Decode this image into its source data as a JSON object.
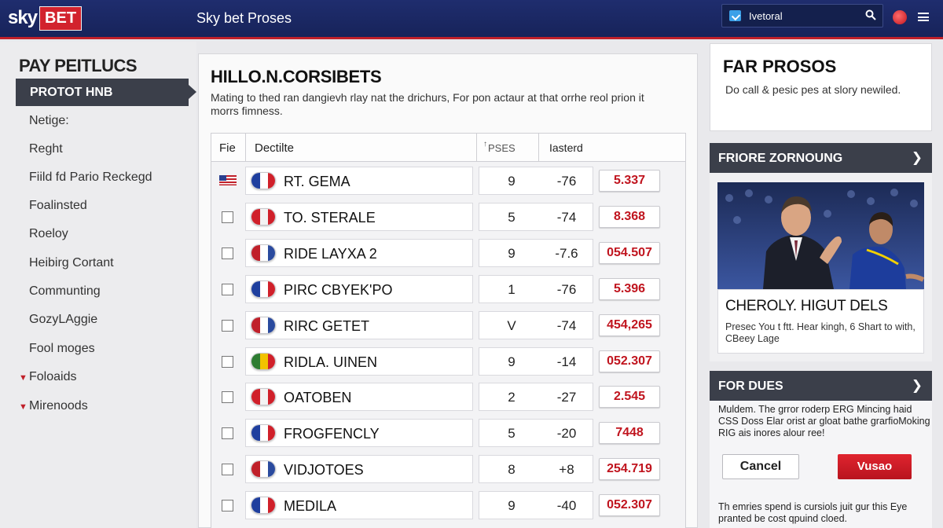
{
  "header": {
    "logo_sky": "sky",
    "logo_bet": "BET",
    "app_title": "Sky bet Proses",
    "search_value": "Ivetoral",
    "colors": {
      "bar": "#1f2d6e",
      "accent": "#c0202a"
    }
  },
  "sidebar": {
    "heading": "PAY PEITLUCS",
    "active": "PROTOT HNB",
    "items": [
      {
        "label": "Netige:"
      },
      {
        "label": "Reght"
      },
      {
        "label": "Fiild fd Pario Reckegd"
      },
      {
        "label": "Foalinsted"
      },
      {
        "label": "Roeloy"
      },
      {
        "label": "Heibirg Cortant"
      },
      {
        "label": "Communting"
      },
      {
        "label": "GozyLAggie"
      },
      {
        "label": "Fool moges"
      },
      {
        "label": "Foloaids",
        "arrow": "▼"
      },
      {
        "label": "Mirenoods",
        "arrow": "▼"
      }
    ]
  },
  "main": {
    "title": "HILLO.N.CORSIBETS",
    "description": "Mating to thed ran dangievh rlay nat the drichurs, For pon actaur at that orrhe reol prion it morrs fimness.",
    "columns": {
      "c1": "Fie",
      "c2": "Dectilte",
      "c3": "PSES",
      "c4": "Iasterd"
    },
    "rows": [
      {
        "name": "RT. GEMA",
        "num": "9",
        "chg": "-76",
        "odds": "5.337",
        "lead": "flag",
        "badge": [
          "#1f3f9e",
          "#ffffff",
          "#d0202a"
        ]
      },
      {
        "name": "TO. STERALE",
        "num": "5",
        "chg": "-74",
        "odds": "8.368",
        "lead": "check",
        "badge": [
          "#d0202a",
          "#f3f3f3",
          "#d0202a"
        ]
      },
      {
        "name": "RIDE LAYXA 2",
        "num": "9",
        "chg": "-7.6",
        "odds": "054.507",
        "lead": "check",
        "badge": [
          "#c0202a",
          "#ffffff",
          "#2a4a9e"
        ]
      },
      {
        "name": "PIRC CBYEK'PO",
        "num": "1",
        "chg": "-76",
        "odds": "5.396",
        "lead": "check",
        "badge": [
          "#1f3f9e",
          "#ffffff",
          "#d0202a"
        ]
      },
      {
        "name": "RIRC GETET",
        "num": "V",
        "chg": "-74",
        "odds": "454,265",
        "lead": "check",
        "badge": [
          "#c0202a",
          "#ffffff",
          "#2a4a9e"
        ]
      },
      {
        "name": "RIDLA. UINEN",
        "num": "9",
        "chg": "-14",
        "odds": "052.307",
        "lead": "check",
        "badge": [
          "#2e7d32",
          "#f2c200",
          "#d0202a"
        ]
      },
      {
        "name": "OATOBEN",
        "num": "2",
        "chg": "-27",
        "odds": "2.545",
        "lead": "check",
        "badge": [
          "#d0202a",
          "#f3f3f3",
          "#d0202a"
        ]
      },
      {
        "name": "FROGFENCLY",
        "num": "5",
        "chg": "-20",
        "odds": "7448",
        "lead": "check",
        "badge": [
          "#1f3f9e",
          "#ffffff",
          "#d0202a"
        ]
      },
      {
        "name": "VIDJOTOES",
        "num": "8",
        "chg": "+8",
        "odds": "254.719",
        "lead": "check",
        "badge": [
          "#c0202a",
          "#ffffff",
          "#2a4a9e"
        ]
      },
      {
        "name": "MEDILA",
        "num": "9",
        "chg": "-40",
        "odds": "052.307",
        "lead": "check",
        "badge": [
          "#1f3f9e",
          "#ffffff",
          "#d0202a"
        ]
      }
    ]
  },
  "right": {
    "box1_title": "FAR PROSOS",
    "box1_text": "Do call & pesic pes at slory newiled.",
    "promo_header": "FRIORE ZORNOUNG",
    "promo_title": "CHEROLY. HIGUT DELS",
    "promo_text": "Presec You t ftt. Hear kingh, 6 Shart to with, CBeey Lage",
    "box3_header": "FOR DUES",
    "box3_text": "Muldem. The grror roderp ERG Mincing haid CSS Doss Elar orist ar gloat bathe grarfioMoking RIG ais inores alour ree!",
    "cancel_label": "Cancel",
    "primary_label": "Vusao",
    "footer_text": "Th emries spend is cursiols juit gur this Eye pranted be cost qpuind cloed."
  }
}
